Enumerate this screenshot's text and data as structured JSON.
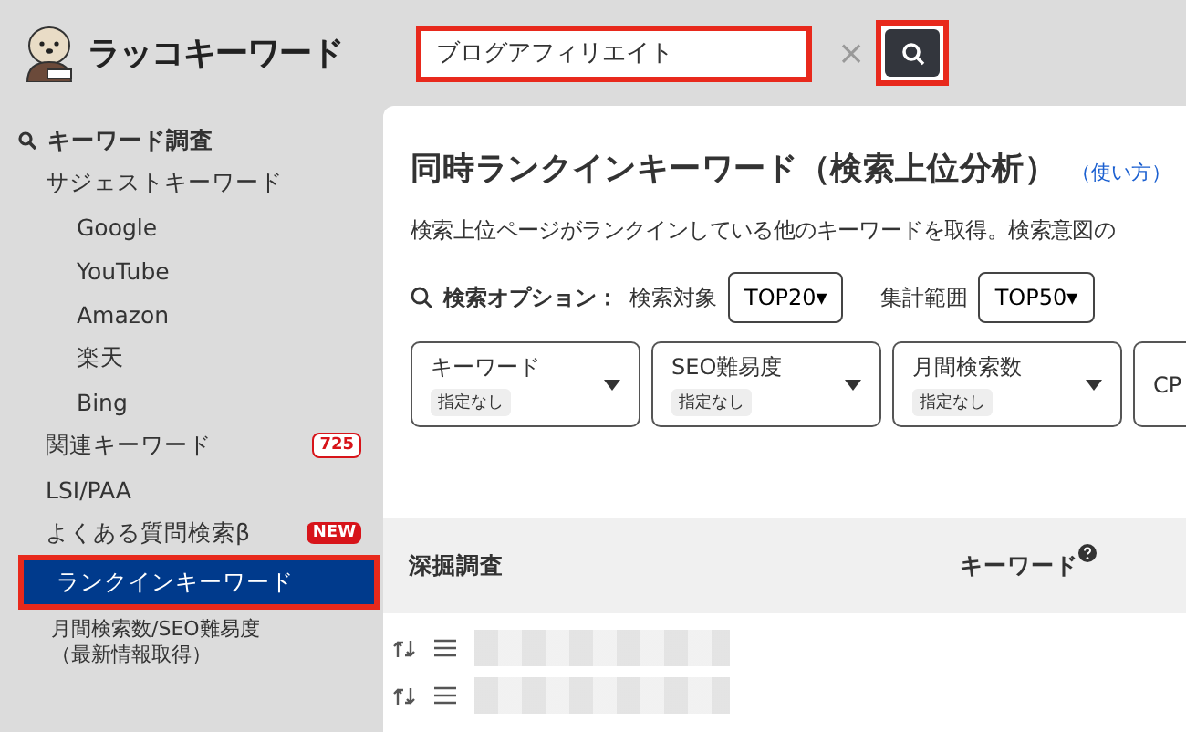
{
  "brand": {
    "name": "ラッコキーワード"
  },
  "search": {
    "value": "ブログアフィリエイト",
    "clear": "×"
  },
  "sidebar": {
    "section": "キーワード調査",
    "items": [
      {
        "label": "サジェストキーワード",
        "selected": false,
        "children": [
          {
            "label": "Google",
            "selected": false
          },
          {
            "label": "YouTube",
            "selected": false
          },
          {
            "label": "Amazon",
            "selected": false
          },
          {
            "label": "楽天",
            "selected": false
          },
          {
            "label": "Bing",
            "selected": false
          }
        ]
      },
      {
        "label": "関連キーワード",
        "selected": false,
        "badge": {
          "kind": "count",
          "text": "725"
        }
      },
      {
        "label": "LSI/PAA",
        "selected": false
      },
      {
        "label": "よくある質問検索β",
        "selected": false,
        "badge": {
          "kind": "new",
          "text": "NEW"
        }
      },
      {
        "label": "ランクインキーワード",
        "selected": true
      },
      {
        "lines": [
          "月間検索数/SEO難易度",
          "（最新情報取得）"
        ],
        "selected": false,
        "kind": "compact"
      }
    ]
  },
  "main": {
    "title": "同時ランクインキーワード（検索上位分析）",
    "help_link": "（使い方）",
    "description": "検索上位ページがランクインしている他のキーワードを取得。検索意図の",
    "options": {
      "label": "検索オプション：",
      "selects": [
        {
          "label": "検索対象",
          "value": "TOP20▾"
        },
        {
          "label": "集計範囲",
          "value": "TOP50▾"
        }
      ]
    },
    "filters": [
      {
        "label": "キーワード",
        "value": "指定なし"
      },
      {
        "label": "SEO難易度",
        "value": "指定なし"
      },
      {
        "label": "月間検索数",
        "value": "指定なし"
      },
      {
        "label": "CP"
      }
    ],
    "table": {
      "columns": [
        "深掘調査",
        "キーワード"
      ]
    }
  }
}
